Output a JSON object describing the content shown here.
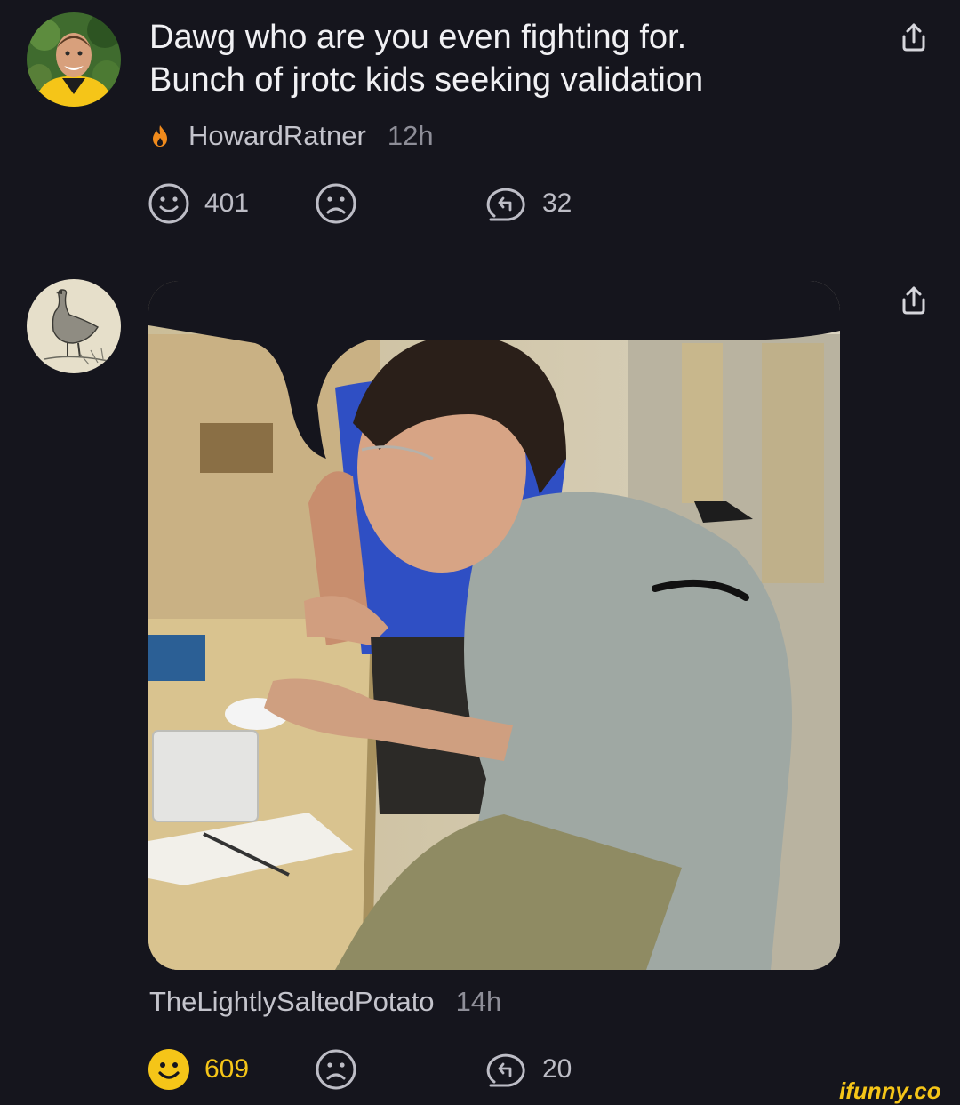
{
  "comments": [
    {
      "text": "Dawg who are you even fighting for.\nBunch of jrotc kids seeking validation",
      "username": "HowardRatner",
      "time": "12h",
      "smile_count": "401",
      "reply_count": "32",
      "avatar_icon": "user-photo-avatar",
      "badge_icon": "flame-icon",
      "smile_active": false
    },
    {
      "username": "TheLightlySaltedPotato",
      "time": "14h",
      "smile_count": "609",
      "reply_count": "20",
      "avatar_icon": "goose-avatar",
      "attachment": "meme-photo",
      "smile_active": true
    }
  ],
  "watermark": "ifunny.co",
  "colors": {
    "background": "#15151d",
    "accent": "#f5c518",
    "badge": "#f08a1c"
  }
}
